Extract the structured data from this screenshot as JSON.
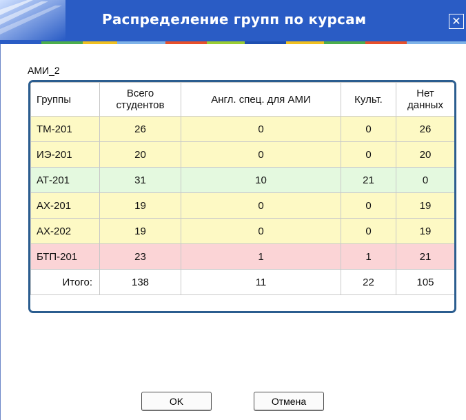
{
  "window": {
    "title": "Распределение групп по курсам",
    "close_label": "✕"
  },
  "colors": {
    "titlebar": "#2a5cc5",
    "row_yellow": "#fdf9c4",
    "row_green": "#e4f9df",
    "row_red": "#fbd4d6",
    "table_border": "#2b5d8f"
  },
  "group_name": "АМИ_2",
  "table": {
    "headers": {
      "groups": "Группы",
      "total_line1": "Всего",
      "total_line2": "студентов",
      "english": "Англ. спец. для АМИ",
      "culture": "Культ.",
      "nodata_line1": "Нет",
      "nodata_line2": "данных"
    },
    "rows": [
      {
        "group": "ТМ-201",
        "total": "26",
        "english": "0",
        "culture": "0",
        "nodata": "26",
        "status": "yellow"
      },
      {
        "group": "ИЭ-201",
        "total": "20",
        "english": "0",
        "culture": "0",
        "nodata": "20",
        "status": "yellow"
      },
      {
        "group": "АТ-201",
        "total": "31",
        "english": "10",
        "culture": "21",
        "nodata": "0",
        "status": "green"
      },
      {
        "group": "АХ-201",
        "total": "19",
        "english": "0",
        "culture": "0",
        "nodata": "19",
        "status": "yellow"
      },
      {
        "group": "АХ-202",
        "total": "19",
        "english": "0",
        "culture": "0",
        "nodata": "19",
        "status": "yellow"
      },
      {
        "group": "БТП-201",
        "total": "23",
        "english": "1",
        "culture": "1",
        "nodata": "21",
        "status": "red"
      }
    ],
    "totals": {
      "label": "Итого:",
      "total": "138",
      "english": "11",
      "culture": "22",
      "nodata": "105"
    }
  },
  "buttons": {
    "ok": "OK",
    "cancel": "Отмена"
  }
}
